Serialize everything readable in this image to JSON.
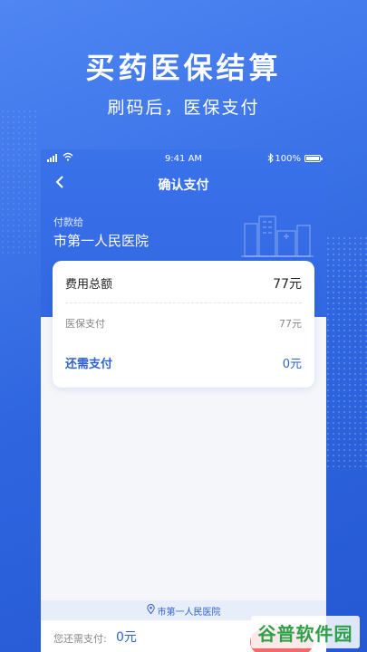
{
  "hero": {
    "title": "买药医保结算",
    "subtitle": "刷码后，医保支付"
  },
  "status_bar": {
    "time": "9:41 AM",
    "battery": "100%"
  },
  "nav": {
    "title": "确认支付"
  },
  "payee": {
    "label": "付款给",
    "name": "市第一人民医院"
  },
  "card": {
    "total_label": "费用总额",
    "total_value": "77元",
    "insurance_label": "医保支付",
    "insurance_value": "77元",
    "due_label": "还需支付",
    "due_value": "0元"
  },
  "footer": {
    "location": "市第一人民医院",
    "due_label": "您还需支付:",
    "due_value": "0元"
  },
  "watermark": "谷普软件园",
  "colors": {
    "primary": "#3267e2",
    "pay_button": "#f26a6a"
  },
  "icons": [
    "back-icon",
    "signal-icon",
    "wifi-icon",
    "bluetooth-icon",
    "battery-icon",
    "location-pin-icon",
    "hospital-building-icon"
  ]
}
